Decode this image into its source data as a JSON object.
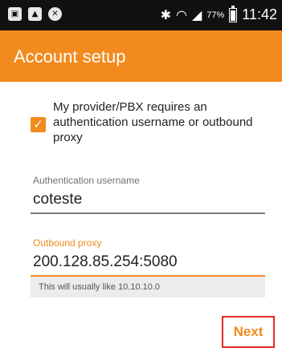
{
  "status_bar": {
    "left_icons": [
      "notification-icon",
      "image-icon",
      "blocked-icon"
    ],
    "battery_percent": "77%",
    "battery_level": 0.77,
    "time": "11:42"
  },
  "app_bar": {
    "title": "Account setup"
  },
  "auth_checkbox": {
    "checked": true,
    "label": "My provider/PBX requires an authentication username or outbound proxy"
  },
  "auth_username": {
    "label": "Authentication username",
    "value": "coteste"
  },
  "outbound_proxy": {
    "label": "Outbound proxy",
    "value": "200.128.85.254:5080",
    "hint": "This will usually like 10.10.10.0"
  },
  "next_button": {
    "label": "Next"
  },
  "colors": {
    "accent": "#f28a1d",
    "highlight_border": "#e52a2a",
    "status_bar": "#111111"
  }
}
